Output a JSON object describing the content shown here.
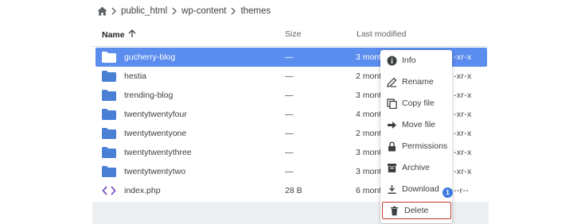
{
  "breadcrumb": {
    "home_icon": "home-icon",
    "items": [
      "public_html",
      "wp-content",
      "themes"
    ]
  },
  "table": {
    "columns": {
      "name": "Name",
      "size": "Size",
      "modified": "Last modified"
    },
    "sort_icon": "arrow-up-icon",
    "rows": [
      {
        "name": "gucherry-blog",
        "size": "—",
        "modified": "3 month",
        "perm": "-xr-x",
        "type": "folder",
        "selected": true
      },
      {
        "name": "hestia",
        "size": "—",
        "modified": "2 month",
        "perm": "-xr-x",
        "type": "folder"
      },
      {
        "name": "trending-blog",
        "size": "—",
        "modified": "3 month",
        "perm": "-xr-x",
        "type": "folder"
      },
      {
        "name": "twentytwentyfour",
        "size": "—",
        "modified": "4 month",
        "perm": "-xr-x",
        "type": "folder"
      },
      {
        "name": "twentytwentyone",
        "size": "—",
        "modified": "2 month",
        "perm": "-xr-x",
        "type": "folder"
      },
      {
        "name": "twentytwentythree",
        "size": "—",
        "modified": "3 month",
        "perm": "-xr-x",
        "type": "folder"
      },
      {
        "name": "twentytwentytwo",
        "size": "—",
        "modified": "3 month",
        "perm": "-xr-x",
        "type": "folder"
      },
      {
        "name": "index.php",
        "size": "28 B",
        "modified": "6 month",
        "perm": "--r--",
        "type": "code"
      }
    ]
  },
  "context_menu": {
    "items": [
      {
        "label": "Info",
        "icon": "info-icon"
      },
      {
        "label": "Rename",
        "icon": "pencil-icon"
      },
      {
        "label": "Copy file",
        "icon": "copy-icon"
      },
      {
        "label": "Move file",
        "icon": "arrow-right-icon"
      },
      {
        "label": "Permissions",
        "icon": "lock-icon"
      },
      {
        "label": "Archive",
        "icon": "archive-icon"
      },
      {
        "label": "Download",
        "icon": "download-icon"
      },
      {
        "label": "Delete",
        "icon": "trash-icon"
      }
    ],
    "badge": "1"
  },
  "colors": {
    "selected_row": "#5b8def",
    "folder": "#4a7fd6",
    "delete_outline": "#c0392b",
    "badge": "#3d7be0"
  }
}
